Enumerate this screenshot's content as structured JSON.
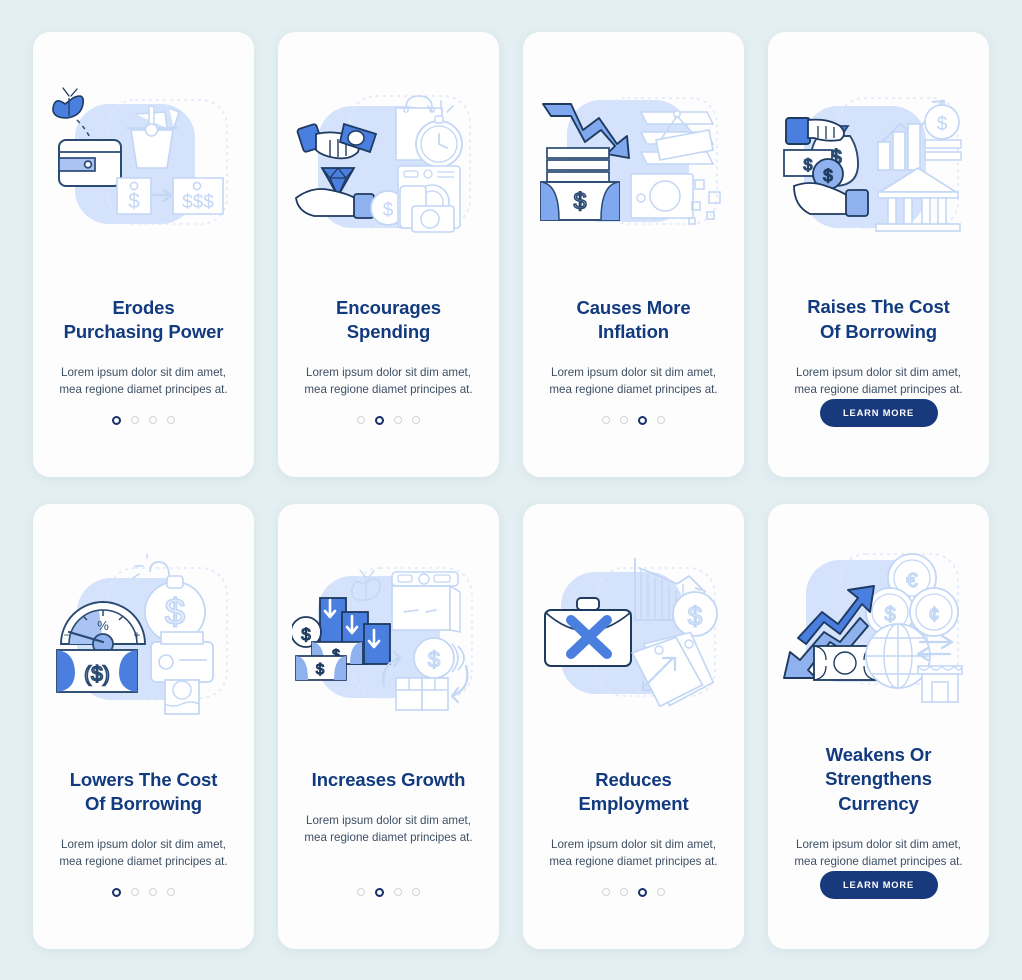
{
  "page": {
    "background_color": "#e3eff2",
    "card_background_color": "#fdfdfe",
    "title_color": "#123a7e",
    "body_color": "#3d4f63",
    "accent_color": "#183a7c",
    "illustration_blue": "#4a7fe0",
    "illustration_light_blue": "#d3e0fa",
    "illustration_outline": "#1e3a5f"
  },
  "shared": {
    "body_text": "Lorem ipsum dolor sit dim amet, mea regione diamet principes at.",
    "learn_more_label": "LEARN MORE",
    "dot_count": 4
  },
  "screens": [
    {
      "id": "erodes-purchasing-power",
      "title": "Erodes\nPurchasing Power",
      "title_lines": [
        "Erodes",
        "Purchasing Power"
      ],
      "body_text": "Lorem ipsum dolor sit dim amet, mea regione diamet principes at.",
      "footer_type": "dots",
      "active_dot": 0,
      "illustration_name": "wallet-moth-basket-price-tags-illustration",
      "illustration_elements": [
        "moth",
        "wallet",
        "shopping-basket",
        "price-tag-single-dollar",
        "arrow-right",
        "price-tag-triple-dollar"
      ]
    },
    {
      "id": "encourages-spending",
      "title": "Encourages Spending",
      "title_lines": [
        "Encourages Spending"
      ],
      "body_text": "Lorem ipsum dolor sit dim amet, mea regione diamet principes at.",
      "footer_type": "dots",
      "active_dot": 1,
      "illustration_name": "hand-cash-diamond-shopping-illustration",
      "illustration_elements": [
        "hand-with-banknotes",
        "diamond",
        "open-palm-hand",
        "shopping-bag",
        "alarm-clock",
        "washing-machine",
        "smartphone",
        "camera",
        "dollar-coin"
      ]
    },
    {
      "id": "causes-more-inflation",
      "title": "Causes More Inflation",
      "title_lines": [
        "Causes More Inflation"
      ],
      "body_text": "Lorem ipsum dolor sit dim amet, mea regione diamet principes at.",
      "footer_type": "dots",
      "active_dot": 2,
      "illustration_name": "falling-arrow-money-stack-printing-illustration",
      "illustration_elements": [
        "down-arrow",
        "banknote-stack",
        "paper-sheets",
        "printing-plate",
        "banknote",
        "small-squares"
      ]
    },
    {
      "id": "raises-the-cost-of-borrowing",
      "title": "Raises The Cost\nOf Borrowing",
      "title_lines": [
        "Raises The Cost",
        "Of Borrowing"
      ],
      "body_text": "Lorem ipsum dolor sit dim amet, mea regione diamet principes at.",
      "footer_type": "button",
      "active_dot": null,
      "illustration_name": "money-bag-hands-bank-chart-illustration",
      "illustration_elements": [
        "hand-giving",
        "money-bag",
        "banknote",
        "dollar-coin",
        "open-hand",
        "rising-chart-arrow",
        "bar-chart",
        "bank-building"
      ]
    },
    {
      "id": "lowers-the-cost-of-borrowing",
      "title": "Lowers The Cost\nOf Borrowing",
      "title_lines": [
        "Lowers The Cost",
        "Of Borrowing"
      ],
      "body_text": "Lorem ipsum dolor sit dim amet, mea regione diamet principes at.",
      "footer_type": "dots",
      "active_dot": 0,
      "illustration_name": "interest-gauge-banknote-money-printer-illustration",
      "illustration_elements": [
        "percent-gauge-meter",
        "banknote-dollar",
        "money-bag-balloon",
        "money-printer"
      ]
    },
    {
      "id": "increases-growth",
      "title": "Increases Growth",
      "title_lines": [
        "Increases Growth"
      ],
      "body_text": "Lorem ipsum dolor sit dim amet, mea regione diamet principes at.",
      "footer_type": "dots",
      "active_dot": 1,
      "illustration_name": "growth-bars-money-goods-illustration",
      "illustration_elements": [
        "bar-steps",
        "down-arrows",
        "dollar-coin",
        "banknotes",
        "moth",
        "television",
        "stacked-coins",
        "boxes",
        "circular-arrows"
      ]
    },
    {
      "id": "reduces-employment",
      "title": "Reduces Employment",
      "title_lines": [
        "Reduces Employment"
      ],
      "body_text": "Lorem ipsum dolor sit dim amet, mea regione diamet principes at.",
      "footer_type": "dots",
      "active_dot": 2,
      "illustration_name": "briefcase-cross-declining-chart-price-tags-illustration",
      "illustration_elements": [
        "briefcase",
        "cross-mark",
        "declining-bar-chart",
        "dollar-coin",
        "price-tags",
        "up-arrow"
      ]
    },
    {
      "id": "weakens-or-strengthens-currency",
      "title": "Weakens Or\nStrengthens Currency",
      "title_lines": [
        "Weakens Or",
        "Strengthens Currency"
      ],
      "body_text": "Lorem ipsum dolor sit dim amet, mea regione diamet principes at.",
      "footer_type": "button",
      "active_dot": null,
      "illustration_name": "currency-arrows-coins-globe-illustration",
      "illustration_elements": [
        "up-arrow",
        "down-arrow",
        "banknote",
        "euro-coin",
        "dollar-coin",
        "cedi-coin",
        "globe",
        "exchange-arrows",
        "shop-storefront"
      ]
    }
  ]
}
